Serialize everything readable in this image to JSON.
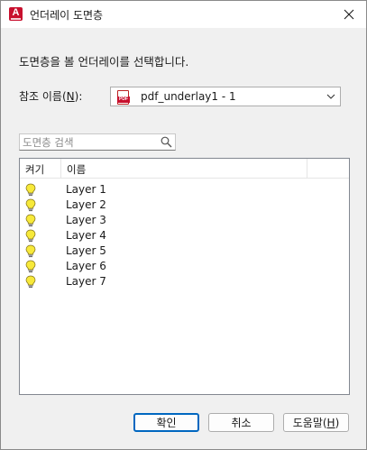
{
  "window": {
    "title": "언더레이 도면층",
    "app_icon": "autocad-icon",
    "app_icon_letter": "A"
  },
  "instruction": "도면층을 볼 언더레이를 선택합니다.",
  "reference": {
    "label_prefix": "참조 이름(",
    "label_mnemonic": "N",
    "label_suffix": "):",
    "selected_value": "pdf_underlay1 - 1",
    "icon": "pdf-file-icon",
    "icon_text": "PDF"
  },
  "search": {
    "placeholder": "도면층 검색",
    "value": ""
  },
  "layer_list": {
    "columns": [
      "켜기",
      "이름"
    ],
    "rows": [
      {
        "on": true,
        "name": "Layer 1"
      },
      {
        "on": true,
        "name": "Layer 2"
      },
      {
        "on": true,
        "name": "Layer 3"
      },
      {
        "on": true,
        "name": "Layer 4"
      },
      {
        "on": true,
        "name": "Layer 5"
      },
      {
        "on": true,
        "name": "Layer 6"
      },
      {
        "on": true,
        "name": "Layer 7"
      }
    ]
  },
  "buttons": {
    "ok": "확인",
    "cancel": "취소",
    "help_prefix": "도움말(",
    "help_mnemonic": "H",
    "help_suffix": ")"
  },
  "colors": {
    "accent": "#0067c0",
    "brand": "#c8102e",
    "bulb_on": "#f7e93a"
  }
}
